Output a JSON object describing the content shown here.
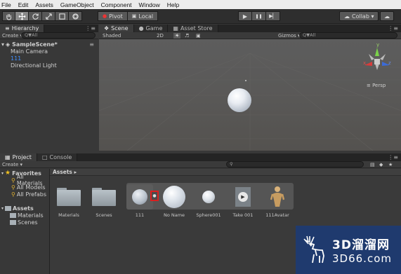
{
  "menu": [
    "File",
    "Edit",
    "Assets",
    "GameObject",
    "Component",
    "Window",
    "Help"
  ],
  "toolbar": {
    "pivot": "Pivot",
    "local": "Local",
    "collab": "Collab ▾",
    "play_icon": "▶",
    "pause_icon": "❚❚",
    "step_icon": "▶▏"
  },
  "hierarchy": {
    "tab": "Hierarchy",
    "create": "Create ▾",
    "search_prefix": "Q▼All",
    "scene": "SampleScene*",
    "items": [
      "Main Camera",
      "111",
      "Directional Light"
    ]
  },
  "scene_view": {
    "tabs": [
      "Scene",
      "Game",
      "Asset Store"
    ],
    "shading": "Shaded",
    "mode_2d": "2D",
    "gizmos": "Gizmos ▾",
    "search_prefix": "Q▼All",
    "persp": "≡ Persp",
    "gizmo_axes": {
      "y": "y",
      "x": "x",
      "z": "z"
    }
  },
  "project": {
    "tabs": [
      "Project",
      "Console"
    ],
    "create": "Create ▾",
    "favorites": "Favorites",
    "favorite_items": [
      "All Materials",
      "All Models",
      "All Prefabs"
    ],
    "assets_root": "Assets",
    "asset_folders": [
      "Materials",
      "Scenes"
    ],
    "breadcrumb": "Assets ▸",
    "assets": [
      "Materials",
      "Scenes",
      "111",
      "No Name",
      "Sphere001",
      "Take 001",
      "111Avatar"
    ]
  },
  "watermark": {
    "line1": "3D溜溜网",
    "line2": "3D66.com"
  },
  "colors": {
    "accent_text": "#3f8fff",
    "highlight_border": "#d92020",
    "watermark_bg": "#1f3a6e"
  }
}
